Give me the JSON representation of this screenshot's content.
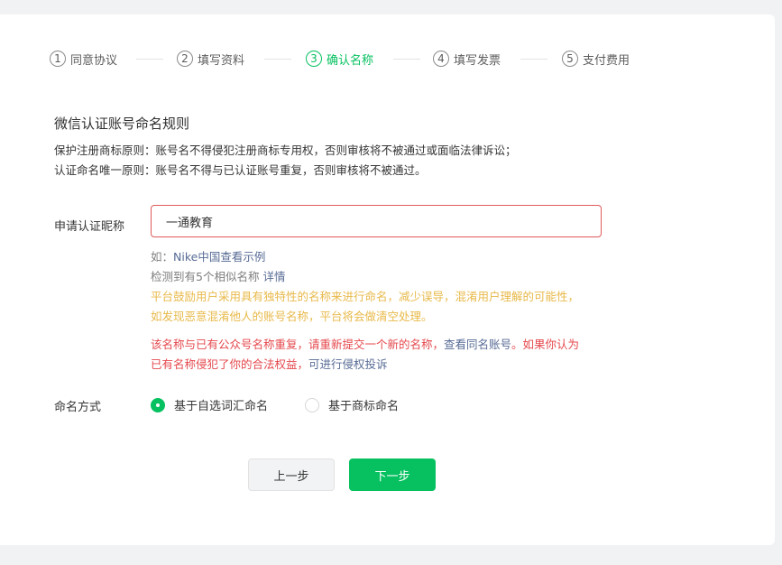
{
  "steps": [
    {
      "num": "1",
      "label": "同意协议"
    },
    {
      "num": "2",
      "label": "填写资料"
    },
    {
      "num": "3",
      "label": "确认名称"
    },
    {
      "num": "4",
      "label": "填写发票"
    },
    {
      "num": "5",
      "label": "支付费用"
    }
  ],
  "active_step": 3,
  "rules": {
    "title": "微信认证账号命名规则",
    "line1": "保护注册商标原则：账号名不得侵犯注册商标专用权，否则审核将不被通过或面临法律诉讼；",
    "line2": "认证命名唯一原则：账号名不得与已认证账号重复，否则审核将不被通过。"
  },
  "name_field": {
    "label": "申请认证昵称",
    "value": "一通教育"
  },
  "hints": {
    "example_prefix": "如：",
    "example_link": "Nike中国查看示例",
    "similar_text": "检测到有5个相似名称 ",
    "similar_link": "详情",
    "tip_line1": "平台鼓励用户采用具有独特性的名称来进行命名，减少误导，混淆用户理解的可能性，",
    "tip_line2": "如发现恶意混淆他人的账号名称，平台将会做清空处理。",
    "error_line1_text": "该名称与已有公众号名称重复，请重新提交一个新的名称，",
    "error_line1_link": "查看同名账号",
    "error_line1_tail": "。如果你认为",
    "error_line2_text": "已有名称侵犯了你的合法权益，",
    "error_line2_link": "可进行侵权投诉"
  },
  "naming_mode": {
    "label": "命名方式",
    "options": [
      "基于自选词汇命名",
      "基于商标命名"
    ],
    "selected_index": 0
  },
  "buttons": {
    "prev": "上一步",
    "next": "下一步"
  },
  "colors": {
    "accent": "#07c160",
    "error": "#e5484d",
    "warning": "#e8b94a",
    "link": "#576b95"
  }
}
